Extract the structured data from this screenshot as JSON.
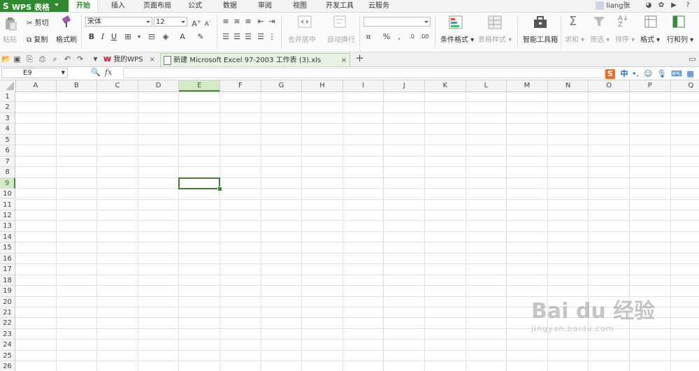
{
  "app": {
    "logo": "S",
    "title": "WPS 表格"
  },
  "menu": {
    "tabs": [
      {
        "label": "开始",
        "active": true
      },
      {
        "label": "插入"
      },
      {
        "label": "页面布局"
      },
      {
        "label": "公式"
      },
      {
        "label": "数据"
      },
      {
        "label": "审阅"
      },
      {
        "label": "视图"
      },
      {
        "label": "开发工具"
      },
      {
        "label": "云服务"
      }
    ],
    "user": "liang张",
    "help": "?"
  },
  "ribbon": {
    "paste": "粘贴",
    "cut": "剪切",
    "copy": "复制",
    "format_painter": "格式刷",
    "font_name": "宋体",
    "font_size": "12",
    "bold": "B",
    "italic": "I",
    "underline": "U",
    "merge_center": "合并居中",
    "wrap_text": "自动换行",
    "number_format": "",
    "percent": "%",
    "comma": ",",
    "conditional_format": "条件格式",
    "table_style": "表格样式",
    "smart_toolbox": "智能工具箱",
    "sum": "求和",
    "filter": "筛选",
    "sort": "排序",
    "format": "格式",
    "rows_cols": "行和列"
  },
  "doc_tabs": {
    "wps_home": "我的WPS",
    "file": "新建 Microsoft Excel 97-2003 工作表 (3).xls",
    "add": "+"
  },
  "formula_bar": {
    "cell_ref": "E9",
    "fx": "fx",
    "formula": ""
  },
  "ime": {
    "logo": "S",
    "lang": "中",
    "punct": "•,"
  },
  "sheet": {
    "columns": [
      "A",
      "B",
      "C",
      "D",
      "E",
      "F",
      "G",
      "H",
      "I",
      "J",
      "K",
      "L",
      "M",
      "N",
      "O",
      "P",
      "Q"
    ],
    "rows": [
      "1",
      "2",
      "3",
      "4",
      "5",
      "6",
      "7",
      "8",
      "9",
      "10",
      "11",
      "12",
      "13",
      "14",
      "15",
      "16",
      "17",
      "18",
      "19",
      "20",
      "21",
      "22",
      "23",
      "24",
      "25",
      "26"
    ],
    "active_column": "E",
    "active_row": "9"
  },
  "watermark": {
    "brand": "Bai du 经验",
    "url": "jingyan.baidu.com"
  },
  "colors": {
    "accent": "#2f8a2f",
    "selection": "#3e7e2e",
    "header_highlight": "#d6e9c6"
  }
}
